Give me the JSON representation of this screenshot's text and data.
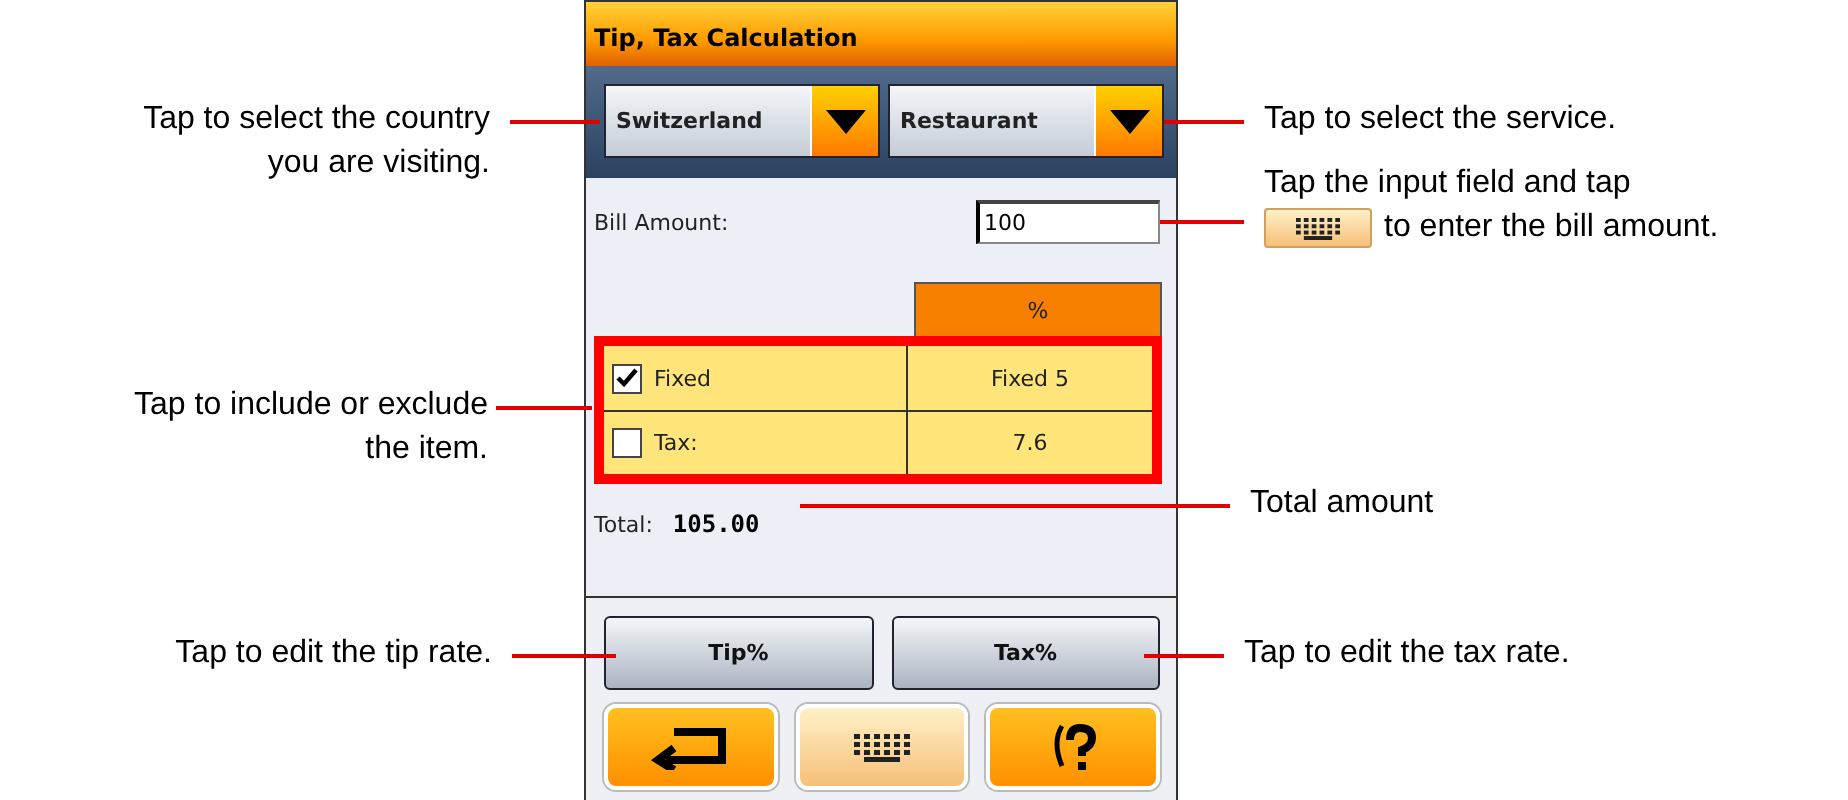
{
  "window": {
    "title": "Tip, Tax Calculation"
  },
  "dropdowns": [
    {
      "label": "Switzerland"
    },
    {
      "label": "Restaurant"
    }
  ],
  "bill": {
    "label": "Bill Amount:",
    "value": "100"
  },
  "table": {
    "header": "%",
    "rows": [
      {
        "label": "Fixed",
        "checked": true,
        "value": "Fixed 5"
      },
      {
        "label": "Tax:",
        "checked": false,
        "value": "7.6"
      }
    ],
    "highlighted": true
  },
  "total": {
    "label": "Total:",
    "value": "105.00"
  },
  "buttons": [
    "Tip%",
    "Tax%"
  ],
  "callouts": [
    {
      "kind": "plain",
      "lines": [
        "Tap to select the country",
        "you are visiting."
      ]
    },
    {
      "kind": "plain",
      "lines": [
        "Tap to select the service."
      ]
    },
    {
      "kind": "key-icon",
      "lines": [
        "Tap the input field and tap",
        "to enter the bill amount."
      ]
    },
    {
      "kind": "plain",
      "lines": [
        "Tap to include or exclude",
        "the item."
      ]
    },
    {
      "kind": "plain",
      "lines": [
        "Total amount"
      ]
    },
    {
      "kind": "plain",
      "lines": [
        "Tap to edit the tip rate."
      ]
    },
    {
      "kind": "plain",
      "lines": [
        "Tap to edit the tax rate."
      ]
    }
  ]
}
